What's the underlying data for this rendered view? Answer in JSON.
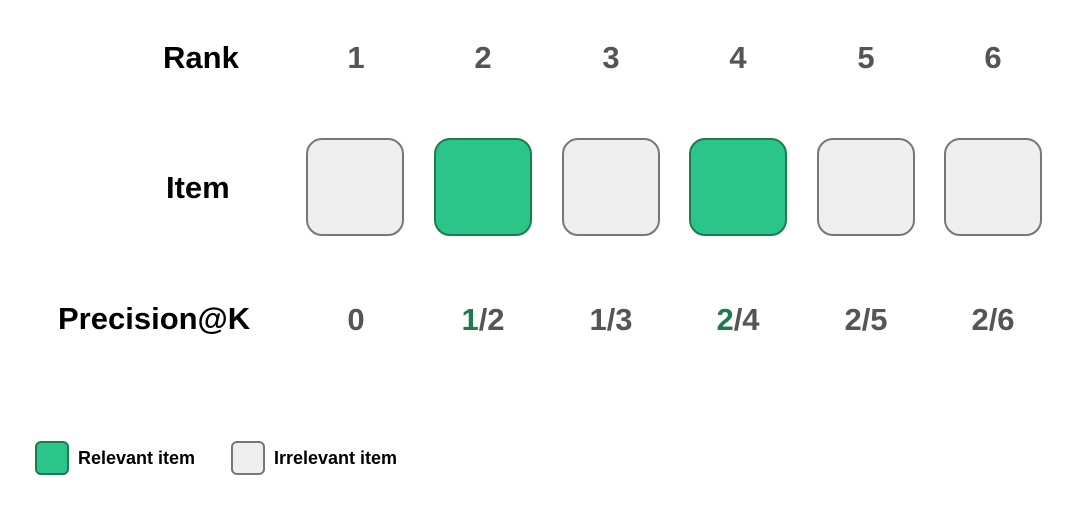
{
  "labels": {
    "rank": "Rank",
    "item": "Item",
    "precision": "Precision@K"
  },
  "ranks": [
    "1",
    "2",
    "3",
    "4",
    "5",
    "6"
  ],
  "items": [
    {
      "relevant": false
    },
    {
      "relevant": true
    },
    {
      "relevant": false
    },
    {
      "relevant": true
    },
    {
      "relevant": false
    },
    {
      "relevant": false
    }
  ],
  "precision": [
    {
      "numerator": "0",
      "rest": ""
    },
    {
      "numerator": "1",
      "rest": "/2"
    },
    {
      "numerator": "1",
      "rest": "/3"
    },
    {
      "numerator": "2",
      "rest": "/4"
    },
    {
      "numerator": "2",
      "rest": "/5"
    },
    {
      "numerator": "2",
      "rest": "/6"
    }
  ],
  "legend": {
    "relevant": "Relevant item",
    "irrelevant": "Irrelevant item"
  },
  "colors": {
    "relevant_fill": "#2bc589",
    "relevant_border": "#1f7a4f",
    "irrelevant_fill": "#efefef",
    "irrelevant_border": "#777777",
    "numeral": "#555555"
  }
}
